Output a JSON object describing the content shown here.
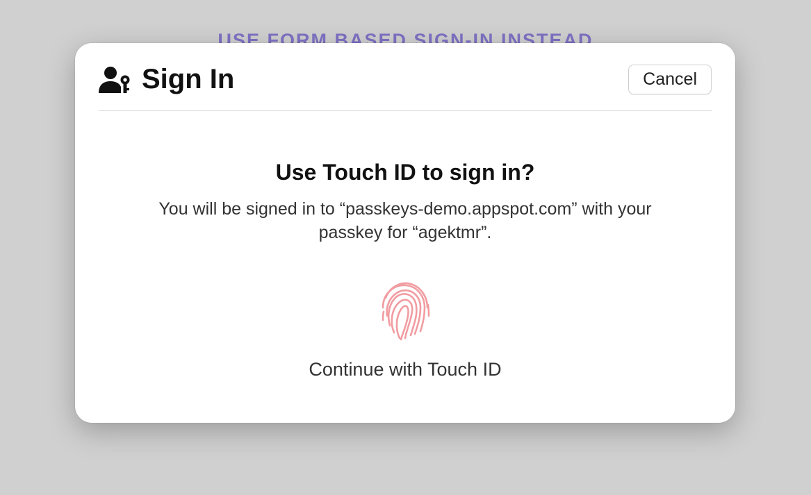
{
  "backdrop": {
    "link_text": "USE FORM BASED SIGN-IN INSTEAD"
  },
  "dialog": {
    "title": "Sign In",
    "cancel_label": "Cancel",
    "body": {
      "heading": "Use Touch ID to sign in?",
      "description": "You will be signed in to “passkeys-demo.appspot.com” with your passkey for “agektmr”.",
      "continue_label": "Continue with Touch ID"
    }
  },
  "colors": {
    "link": "#7e72c4",
    "fingerprint": "#f19ca1"
  }
}
